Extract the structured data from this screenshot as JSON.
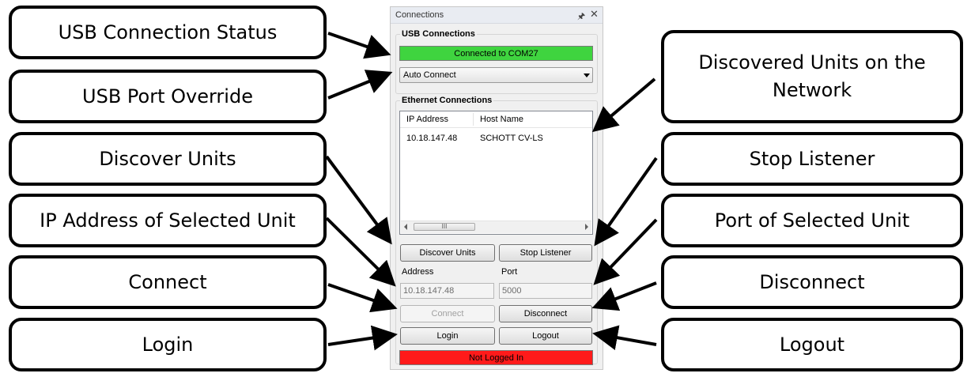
{
  "callouts": {
    "usb_connection_status": "USB Connection Status",
    "usb_port_override": "USB Port Override",
    "discover_units": "Discover Units",
    "ip_address_selected": "IP Address of Selected Unit",
    "connect": "Connect",
    "login": "Login",
    "discovered_units_line1": "Discovered Units on the",
    "discovered_units_line2": "Network",
    "stop_listener": "Stop Listener",
    "port_selected": "Port of Selected Unit",
    "disconnect": "Disconnect",
    "logout": "Logout"
  },
  "panel": {
    "title": "Connections",
    "pin_glyph": "p",
    "close_glyph": "✕",
    "usb": {
      "group_label": "USB Connections",
      "status_text": "Connected to COM27",
      "status_color": "#3fd43f",
      "port_selected": "Auto Connect"
    },
    "ethernet": {
      "group_label": "Ethernet Connections",
      "columns": [
        "IP Address",
        "Host Name"
      ],
      "rows": [
        {
          "ip": "10.18.147.48",
          "host": "SCHOTT CV-LS"
        }
      ],
      "scroll_thumb": "III",
      "discover_button": "Discover Units",
      "stop_button": "Stop Listener",
      "address_label": "Address",
      "port_label": "Port",
      "address_value": "10.18.147.48",
      "port_value": "5000",
      "connect_button": "Connect",
      "disconnect_button": "Disconnect",
      "login_button": "Login",
      "logout_button": "Logout",
      "login_status": "Not Logged In",
      "login_status_color": "#ff1a1a"
    }
  }
}
